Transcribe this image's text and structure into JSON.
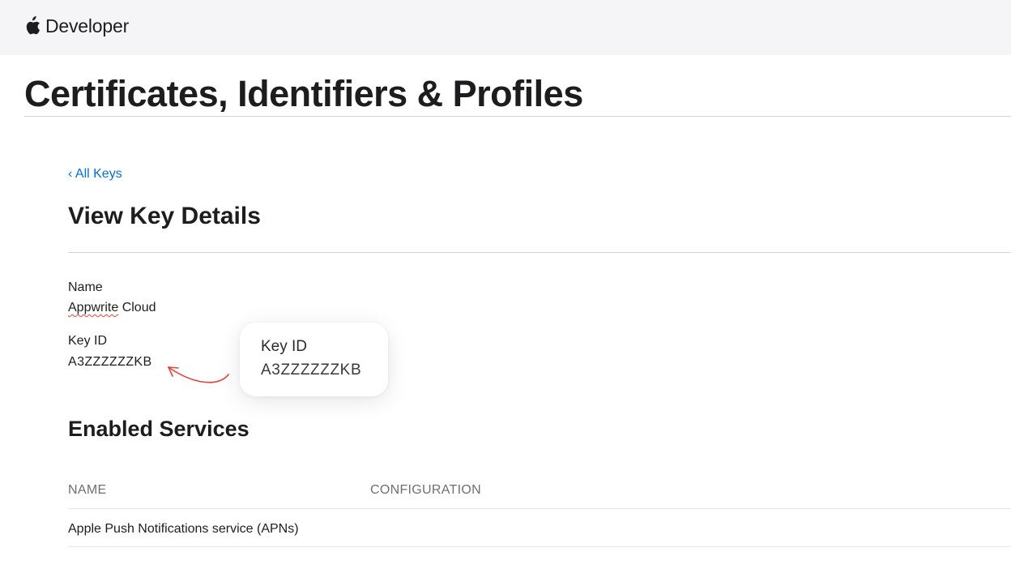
{
  "header": {
    "brand_text": "Developer",
    "logo_icon": "apple-logo-icon"
  },
  "page_title": "Certificates, Identifiers & Profiles",
  "back_link": "‹ All Keys",
  "section_title": "View Key Details",
  "fields": {
    "name_label": "Name",
    "name_value": "Appwrite Cloud",
    "name_value_part1": "Appwrite",
    "name_value_part2": " Cloud",
    "key_id_label": "Key ID",
    "key_id_value": "A3ZZZZZZKB"
  },
  "callout": {
    "label": "Key ID",
    "value": "A3ZZZZZZKB"
  },
  "services": {
    "title": "Enabled Services",
    "columns": [
      "NAME",
      "CONFIGURATION"
    ],
    "rows": [
      {
        "name": "Apple Push Notifications service (APNs)",
        "configuration": ""
      }
    ]
  },
  "colors": {
    "link": "#0071e3",
    "annotation_arrow": "#e0443e",
    "topbar_bg": "#f5f5f7"
  }
}
